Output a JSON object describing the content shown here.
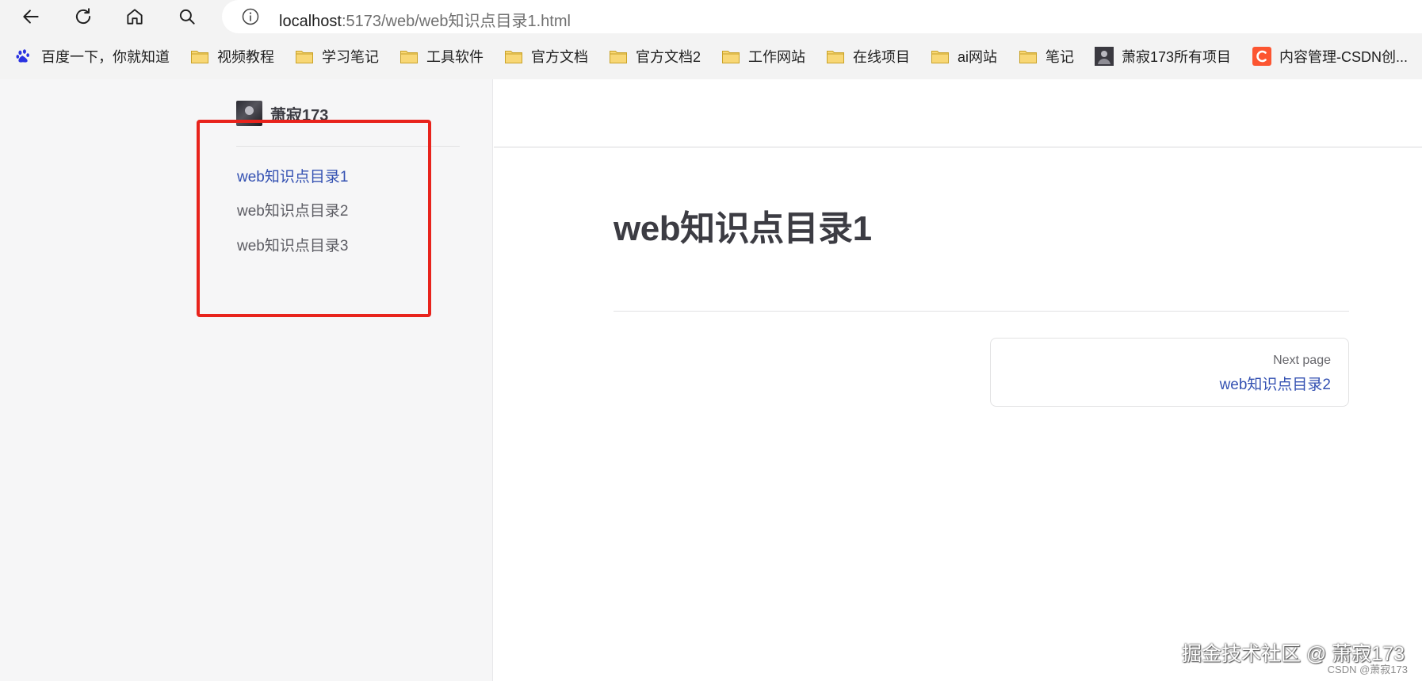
{
  "browser": {
    "url_host": "localhost",
    "url_rest": ":5173/web/web知识点目录1.html"
  },
  "bookmarks": [
    {
      "label": "百度一下，你就知道",
      "icon": "baidu-paw-icon"
    },
    {
      "label": "视频教程",
      "icon": "folder-icon"
    },
    {
      "label": "学习笔记",
      "icon": "folder-icon"
    },
    {
      "label": "工具软件",
      "icon": "folder-icon"
    },
    {
      "label": "官方文档",
      "icon": "folder-icon"
    },
    {
      "label": "官方文档2",
      "icon": "folder-icon"
    },
    {
      "label": "工作网站",
      "icon": "folder-icon"
    },
    {
      "label": "在线项目",
      "icon": "folder-icon"
    },
    {
      "label": "ai网站",
      "icon": "folder-icon"
    },
    {
      "label": "笔记",
      "icon": "folder-icon"
    },
    {
      "label": "萧寂173所有项目",
      "icon": "avatar-icon"
    },
    {
      "label": "内容管理-CSDN创...",
      "icon": "csdn-icon"
    }
  ],
  "site": {
    "title": "萧寂173"
  },
  "sidebar": {
    "items": [
      {
        "label": "web知识点目录1",
        "active": true
      },
      {
        "label": "web知识点目录2",
        "active": false
      },
      {
        "label": "web知识点目录3",
        "active": false
      }
    ]
  },
  "doc": {
    "title": "web知识点目录1"
  },
  "next_page": {
    "desc": "Next page",
    "title": "web知识点目录2"
  },
  "watermark": {
    "main": "掘金技术社区 @ 萧寂173",
    "sub": "CSDN @萧寂173"
  },
  "colors": {
    "accent": "#3451b2",
    "highlight_box": "#e8231c",
    "folder_fill": "#f8d775",
    "folder_stroke": "#c9a227",
    "csdn": "#fc5531"
  }
}
